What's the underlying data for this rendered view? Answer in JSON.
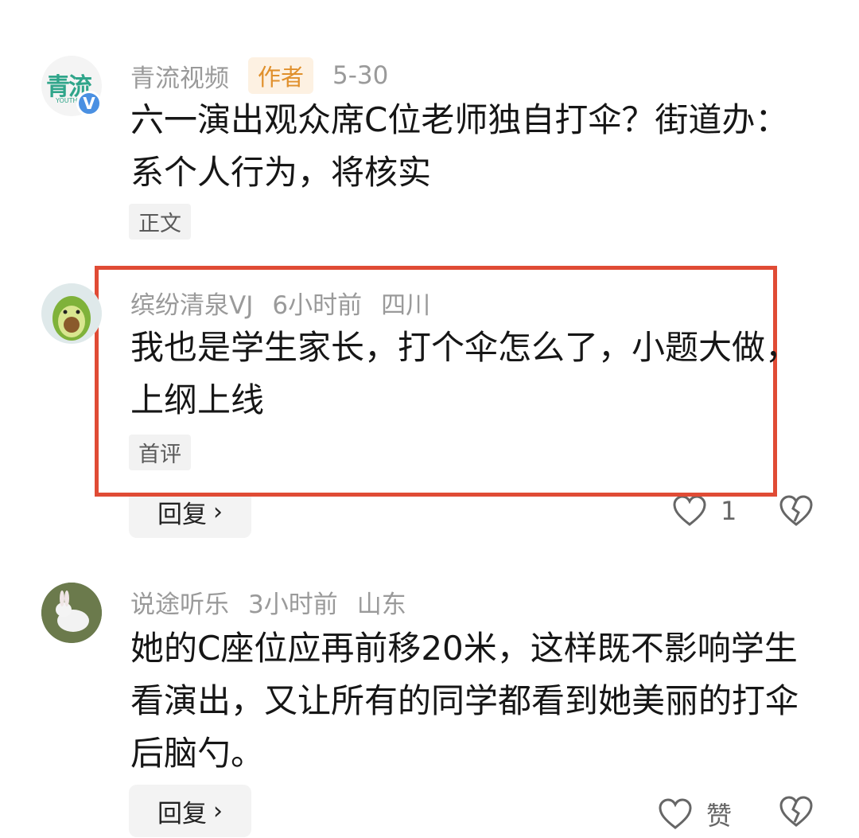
{
  "comments": [
    {
      "username": "青流视频",
      "badge": "作者",
      "time": "5-30",
      "text": "六一演出观众席C位老师独自打伞？街道办：系个人行为，将核实",
      "tag": "正文",
      "avatar_logo": "青流",
      "avatar_logo_sub": "YOUTH"
    },
    {
      "username": "缤纷清泉VJ",
      "time": "6小时前",
      "location": "四川",
      "text": "我也是学生家长，打个伞怎么了，小题大做，上纲上线",
      "tag": "首评",
      "reply_label": "回复",
      "like_count": "1"
    },
    {
      "username": "说途听乐",
      "time": "3小时前",
      "location": "山东",
      "text": "她的C座位应再前移20米，这样既不影响学生看演出，又让所有的同学都看到她美丽的打伞后脑勺。",
      "reply_label": "回复",
      "like_label": "赞"
    }
  ],
  "icons": {
    "chevron": "chevron-right-icon",
    "like": "heart-icon",
    "dislike": "broken-heart-icon",
    "verified": "verified-v-icon"
  },
  "colors": {
    "highlight_box": "#e04b35",
    "author_badge_bg": "#fdf1e2",
    "author_badge_text": "#e0902c",
    "verified": "#4a90e2"
  }
}
